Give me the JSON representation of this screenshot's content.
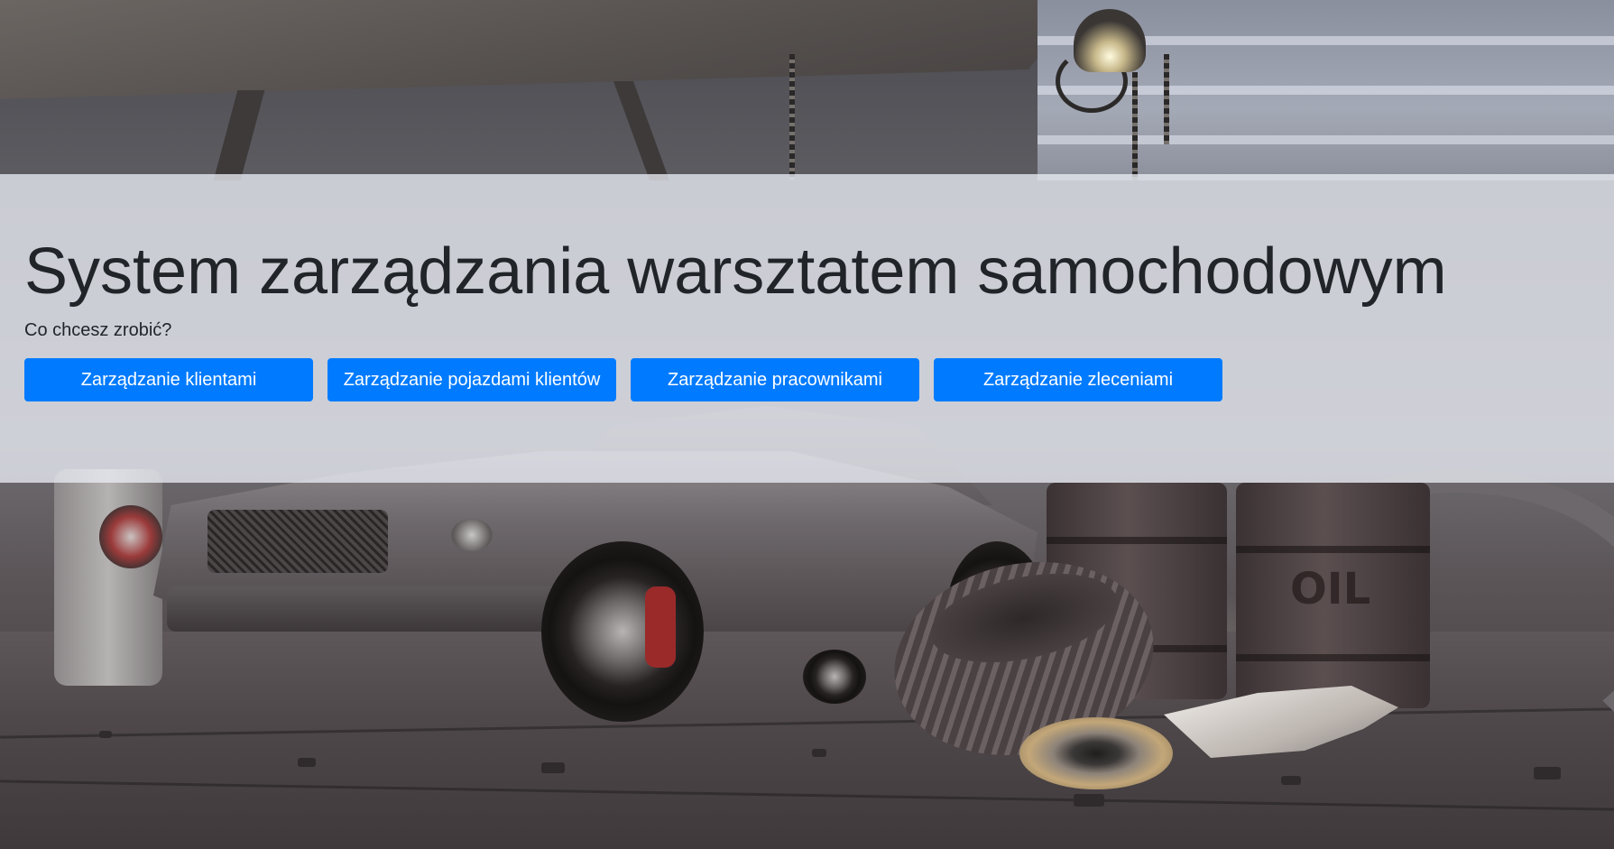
{
  "header": {
    "title": "System zarządzania warsztatem samochodowym",
    "subtitle": "Co chcesz zrobić?"
  },
  "actions": [
    {
      "label": "Zarządzanie klientami"
    },
    {
      "label": "Zarządzanie pojazdami klientów"
    },
    {
      "label": "Zarządzanie pracownikami"
    },
    {
      "label": "Zarządzanie zleceniami"
    }
  ],
  "background": {
    "barrel_label": "OIL"
  },
  "colors": {
    "primary": "#007bff",
    "jumbotron": "#e9ecef",
    "text": "#212529"
  }
}
